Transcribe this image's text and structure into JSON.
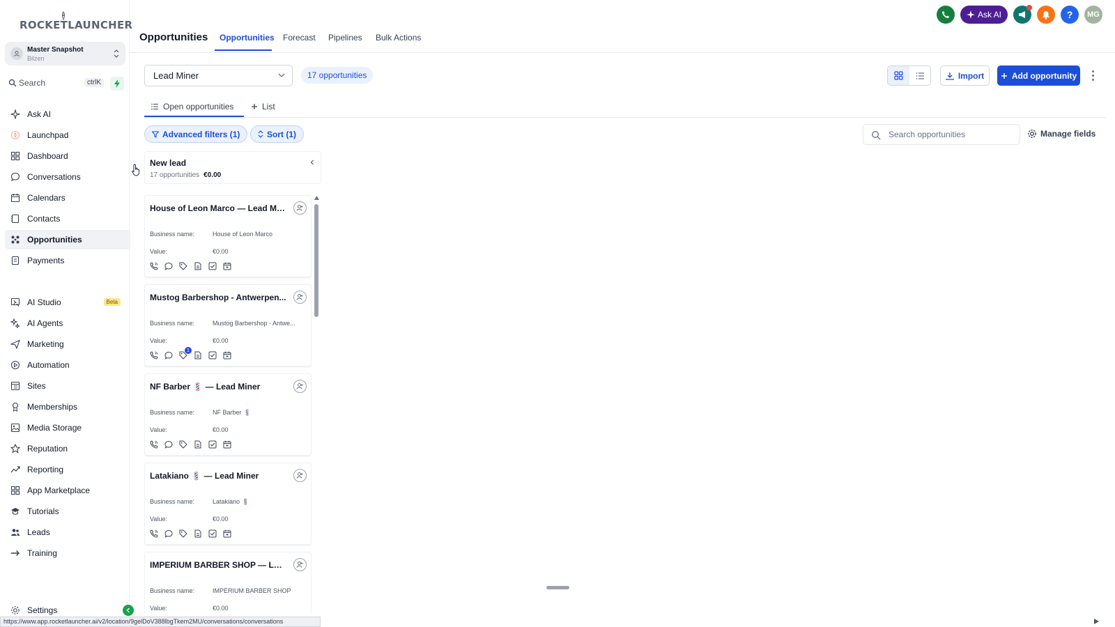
{
  "brand": {
    "name": "ROCKETLAUNCHER"
  },
  "account": {
    "name": "Master Snapshot",
    "location": "Bilzen"
  },
  "search": {
    "label": "Search",
    "shortcut": "ctrlK"
  },
  "sidebar": {
    "items": [
      {
        "label": "Ask AI",
        "icon": "sparkle-icon"
      },
      {
        "label": "Launchpad",
        "icon": "rocket-icon"
      },
      {
        "label": "Dashboard",
        "icon": "grid-icon"
      },
      {
        "label": "Conversations",
        "icon": "chat-icon"
      },
      {
        "label": "Calendars",
        "icon": "calendar-icon"
      },
      {
        "label": "Contacts",
        "icon": "contacts-icon"
      },
      {
        "label": "Opportunities",
        "icon": "opportunities-icon"
      },
      {
        "label": "Payments",
        "icon": "payments-icon"
      },
      {
        "label": "AI Studio",
        "icon": "ai-studio-icon",
        "badge": "Beta"
      },
      {
        "label": "AI Agents",
        "icon": "ai-agents-icon"
      },
      {
        "label": "Marketing",
        "icon": "send-icon"
      },
      {
        "label": "Automation",
        "icon": "automation-icon"
      },
      {
        "label": "Sites",
        "icon": "sites-icon"
      },
      {
        "label": "Memberships",
        "icon": "membership-icon"
      },
      {
        "label": "Media Storage",
        "icon": "image-icon"
      },
      {
        "label": "Reputation",
        "icon": "star-icon"
      },
      {
        "label": "Reporting",
        "icon": "trend-icon"
      },
      {
        "label": "App Marketplace",
        "icon": "apps-icon"
      },
      {
        "label": "Tutorials",
        "icon": "graduation-icon"
      },
      {
        "label": "Leads",
        "icon": "users-icon"
      },
      {
        "label": "Training",
        "icon": "arrow-right-icon"
      }
    ],
    "active": "Opportunities",
    "settings_label": "Settings"
  },
  "header": {
    "title": "Opportunities",
    "tabs": [
      "Opportunities",
      "Forecast",
      "Pipelines",
      "Bulk Actions"
    ],
    "active_tab": "Opportunities",
    "ask_ai_label": "Ask AI",
    "avatar_initials": "MG",
    "help_label": "?"
  },
  "toolbar": {
    "pipeline": "Lead Miner",
    "count_label": "17 opportunities",
    "import_label": "Import",
    "add_label": "Add opportunity"
  },
  "subtabs": {
    "open_label": "Open opportunities",
    "list_label": "List"
  },
  "filters": {
    "advanced_label": "Advanced filters (1)",
    "sort_label": "Sort (1)",
    "search_placeholder": "Search opportunities",
    "manage_fields_label": "Manage fields"
  },
  "stage": {
    "name": "New lead",
    "count": "17 opportunities",
    "total": "€0.00"
  },
  "card_labels": {
    "business": "Business name:",
    "value": "Value:"
  },
  "cards": [
    {
      "title": "House of Leon Marco — Lead Miner",
      "business": "House of Leon Marco",
      "value": "€0.00",
      "tag_badge": ""
    },
    {
      "title": "Mustog Barbershop - Antwerpen...",
      "business": "Mustog Barbershop - Antwe...",
      "value": "€0.00",
      "tag_badge": "1"
    },
    {
      "title": "NF Barber 💈 — Lead Miner",
      "business": "NF Barber 💈",
      "value": "€0.00",
      "tag_badge": ""
    },
    {
      "title": "Latakiano 💈 — Lead Miner",
      "business": "Latakiano 💈",
      "value": "€0.00",
      "tag_badge": ""
    },
    {
      "title": "IMPERIUM BARBER SHOP — Lead...",
      "business": "IMPERIUM BARBER SHOP",
      "value": "€0.00",
      "tag_badge": ""
    }
  ],
  "statusbar": {
    "url": "https://www.app.rocketlauncher.ai/v2/location/9gelDoV388lbgTkem2MU/conversations/conversations"
  },
  "colors": {
    "primary": "#1d4ed8",
    "ask_ai": "#4c1d95",
    "phone": "#15803d",
    "bell": "#f97316",
    "help": "#2563eb",
    "avatar": "#a3b3a0"
  }
}
